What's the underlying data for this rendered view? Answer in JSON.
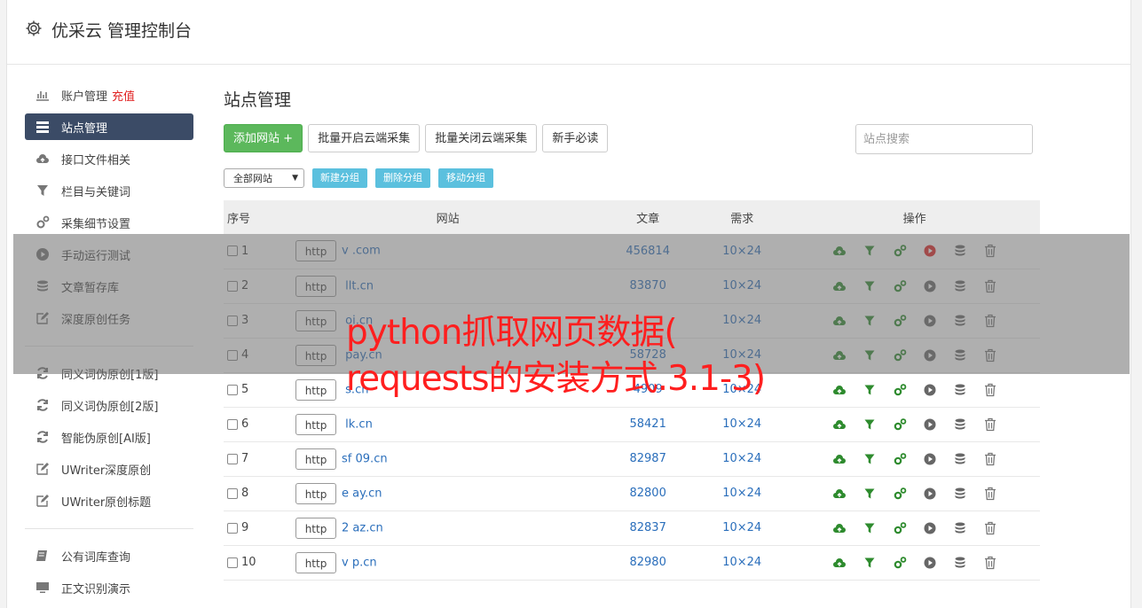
{
  "app": {
    "title": "优采云 管理控制台"
  },
  "sidebar": {
    "groups": [
      [
        {
          "label": "账户管理",
          "badge": "充值",
          "icon": "bar-chart-icon"
        },
        {
          "label": "站点管理",
          "icon": "server-list-icon",
          "active": true
        },
        {
          "label": "接口文件相关",
          "icon": "cloud-upload-icon"
        },
        {
          "label": "栏目与关键词",
          "icon": "filter-icon"
        },
        {
          "label": "采集细节设置",
          "icon": "gears-icon"
        },
        {
          "label": "手动运行测试",
          "icon": "play-circle-icon"
        },
        {
          "label": "文章暂存库",
          "icon": "database-icon"
        },
        {
          "label": "深度原创任务",
          "icon": "edit-icon"
        }
      ],
      [
        {
          "label": "同义词伪原创[1版]",
          "icon": "refresh-icon"
        },
        {
          "label": "同义词伪原创[2版]",
          "icon": "refresh-icon"
        },
        {
          "label": "智能伪原创[AI版]",
          "icon": "refresh-icon"
        },
        {
          "label": "UWriter深度原创",
          "icon": "edit-icon"
        },
        {
          "label": "UWriter原创标题",
          "icon": "edit-icon"
        }
      ],
      [
        {
          "label": "公有词库查询",
          "icon": "book-icon"
        },
        {
          "label": "正文识别演示",
          "icon": "monitor-icon"
        }
      ]
    ]
  },
  "main": {
    "title": "站点管理",
    "toolbar": {
      "add_site": "添加网站 +",
      "batch_open": "批量开启云端采集",
      "batch_close": "批量关闭云端采集",
      "newbie": "新手必读",
      "search_placeholder": "站点搜索"
    },
    "group_bar": {
      "select_value": "全部网站",
      "new_group": "新建分组",
      "delete_group": "删除分组",
      "move_group": "移动分组"
    },
    "table": {
      "headers": {
        "seq": "序号",
        "site": "网站",
        "articles": "文章",
        "demand": "需求",
        "ops": "操作"
      },
      "rows": [
        {
          "seq": "1",
          "protocol": "http",
          "domain": "v                .com",
          "articles": "456814",
          "demand": "10×24",
          "running": true
        },
        {
          "seq": "2",
          "protocol": "http",
          "domain": "        llt.cn",
          "articles": "83870",
          "demand": "10×24"
        },
        {
          "seq": "3",
          "protocol": "http",
          "domain": "          oi.cn",
          "articles": "",
          "demand": "10×24"
        },
        {
          "seq": "4",
          "protocol": "http",
          "domain": "         pay.cn",
          "articles": "58728",
          "demand": "10×24"
        },
        {
          "seq": "5",
          "protocol": "http",
          "domain": "          s.cn",
          "articles": "4909",
          "demand": "10×24"
        },
        {
          "seq": "6",
          "protocol": "http",
          "domain": "       lk.cn",
          "articles": "58421",
          "demand": "10×24"
        },
        {
          "seq": "7",
          "protocol": "http",
          "domain": "sf   09.cn",
          "articles": "82987",
          "demand": "10×24"
        },
        {
          "seq": "8",
          "protocol": "http",
          "domain": "e      ay.cn",
          "articles": "82800",
          "demand": "10×24"
        },
        {
          "seq": "9",
          "protocol": "http",
          "domain": "2      az.cn",
          "articles": "82837",
          "demand": "10×24"
        },
        {
          "seq": "10",
          "protocol": "http",
          "domain": "v      p.cn",
          "articles": "82980",
          "demand": "10×24"
        }
      ]
    }
  },
  "overlay": {
    "line1": "python抓取网页数据(",
    "line2": "requests的安装方式.3.1-3)"
  },
  "colors": {
    "accent_green": "#5cb85c",
    "info_blue": "#5bc0de",
    "active_nav": "#3b4b66",
    "link_blue": "#2a6ebb",
    "overlay_red": "#ff1f1f",
    "run_red": "#e02020"
  }
}
